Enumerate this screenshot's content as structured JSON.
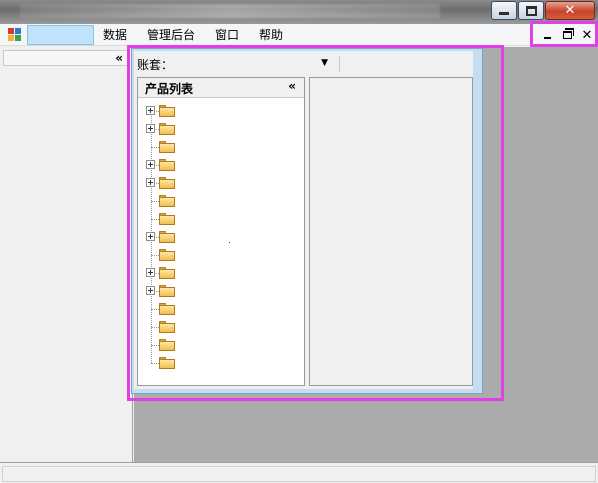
{
  "window": {
    "buttons": {
      "minimize_icon": "minimize-icon",
      "maximize_icon": "maximize-icon",
      "close_icon": "close-icon"
    }
  },
  "menubar": {
    "items": [
      {
        "label": "数据"
      },
      {
        "label": "管理后台"
      },
      {
        "label": "窗口"
      },
      {
        "label": "帮助"
      }
    ],
    "mdi_controls": {
      "minimize": "minimize-icon",
      "restore": "restore-icon",
      "close_label": "✕"
    }
  },
  "left_panel": {
    "collapse_label": "«"
  },
  "child_window": {
    "account_label": "账套：",
    "account_value": "",
    "list_title": "产品列表",
    "list_collapse_label": "«",
    "tree_nodes": [
      {
        "expandable": true
      },
      {
        "expandable": true
      },
      {
        "expandable": false
      },
      {
        "expandable": true
      },
      {
        "expandable": true
      },
      {
        "expandable": false
      },
      {
        "expandable": false
      },
      {
        "expandable": true
      },
      {
        "expandable": false
      },
      {
        "expandable": true
      },
      {
        "expandable": true
      },
      {
        "expandable": false
      },
      {
        "expandable": false
      },
      {
        "expandable": false
      },
      {
        "expandable": false
      }
    ]
  },
  "colors": {
    "highlight": "#e040e8",
    "app_area_bg": "#ababab",
    "child_frame": "#c6ddef",
    "menu_input_bg": "#bfe3fb",
    "close_button": "#c8432a"
  }
}
